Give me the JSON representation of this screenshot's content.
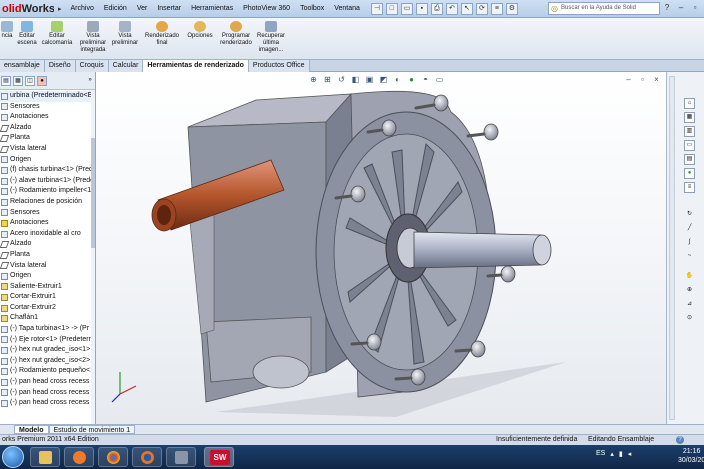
{
  "app": {
    "logo_left": "olid",
    "logo_right": "Works"
  },
  "menu": [
    "Archivo",
    "Edición",
    "Ver",
    "Insertar",
    "Herramientas",
    "PhotoView 360",
    "Toolbox",
    "Ventana"
  ],
  "search": {
    "placeholder": "Buscar en la Ayuda de Solid"
  },
  "commands": [
    {
      "label": "ncia",
      "icon": "render-icon"
    },
    {
      "label": "Editar escena",
      "icon": "scene-icon"
    },
    {
      "label": "Editar calcomanía",
      "icon": "decal-icon"
    },
    {
      "label": "Vista preliminar integrada",
      "icon": "preview-icon"
    },
    {
      "label": "Vista preliminar",
      "icon": "preview-window-icon"
    },
    {
      "label": "Renderizado final",
      "icon": "final-render-icon"
    },
    {
      "label": "Opciones",
      "icon": "options-icon"
    },
    {
      "label": "Programar renderizado",
      "icon": "schedule-icon"
    },
    {
      "label": "Recuperar última imagen...",
      "icon": "recover-icon"
    }
  ],
  "tabs": [
    "ensamblaje",
    "Diseño",
    "Croquis",
    "Calcular",
    "Herramientas de renderizado",
    "Productos Office"
  ],
  "active_tab": "Herramientas de renderizado",
  "tree": [
    {
      "label": "urbina (Predeterminado<Est",
      "icon": "assembly"
    },
    {
      "label": "Sensores",
      "icon": "folder"
    },
    {
      "label": "Anotaciones",
      "icon": "folder"
    },
    {
      "label": "Alzado",
      "icon": "plane"
    },
    {
      "label": "Planta",
      "icon": "plane"
    },
    {
      "label": "Vista lateral",
      "icon": "plane"
    },
    {
      "label": "Origen",
      "icon": "origin"
    },
    {
      "label": "(f) chasis turbina<1> (Pred",
      "icon": "part"
    },
    {
      "label": "(-) alave turbina<1> (Prede",
      "icon": "part"
    },
    {
      "label": "(-) Rodamiento impeller<1",
      "icon": "part"
    },
    {
      "label": "Relaciones de posición",
      "icon": "folder"
    },
    {
      "label": "Sensores",
      "icon": "folder"
    },
    {
      "label": "Anotaciones",
      "icon": "warn"
    },
    {
      "label": "Acero inoxidable al cro",
      "icon": "material"
    },
    {
      "label": "Alzado",
      "icon": "plane"
    },
    {
      "label": "Planta",
      "icon": "plane"
    },
    {
      "label": "Vista lateral",
      "icon": "plane"
    },
    {
      "label": "Origen",
      "icon": "origin"
    },
    {
      "label": "Saliente-Extruir1",
      "icon": "ext"
    },
    {
      "label": "Cortar-Extruir1",
      "icon": "ext"
    },
    {
      "label": "Cortar-Extruir2",
      "icon": "ext"
    },
    {
      "label": "Chaflán1",
      "icon": "ext"
    },
    {
      "label": "(-) Tapa turbina<1> -> (Pr",
      "icon": "part"
    },
    {
      "label": "(-) Eje rotor<1> (Predeterm",
      "icon": "part"
    },
    {
      "label": "(-) hex nut gradec_iso<1> (",
      "icon": "part"
    },
    {
      "label": "(-) hex nut gradec_iso<2> (",
      "icon": "part"
    },
    {
      "label": "(-) Rodamiento pequeño<1",
      "icon": "part"
    },
    {
      "label": "(-) pan head cross recess sc",
      "icon": "part"
    },
    {
      "label": "(-) pan head cross recess sc",
      "icon": "part"
    },
    {
      "label": "(-) pan head cross recess sc",
      "icon": "part"
    }
  ],
  "bottom_tabs": [
    "Modelo",
    "Estudio de movimiento 1"
  ],
  "status": {
    "left": "orks Premium 2011 x64 Edition",
    "definition": "Insuficientemente definida",
    "mode": "Editando Ensamblaje"
  },
  "taskbar": {
    "lang": "ES",
    "time": "21:16",
    "date": "30/03/20"
  },
  "colors": {
    "accent": "#c8102e",
    "rod": "#b5562c",
    "body": "#8f94a3"
  }
}
